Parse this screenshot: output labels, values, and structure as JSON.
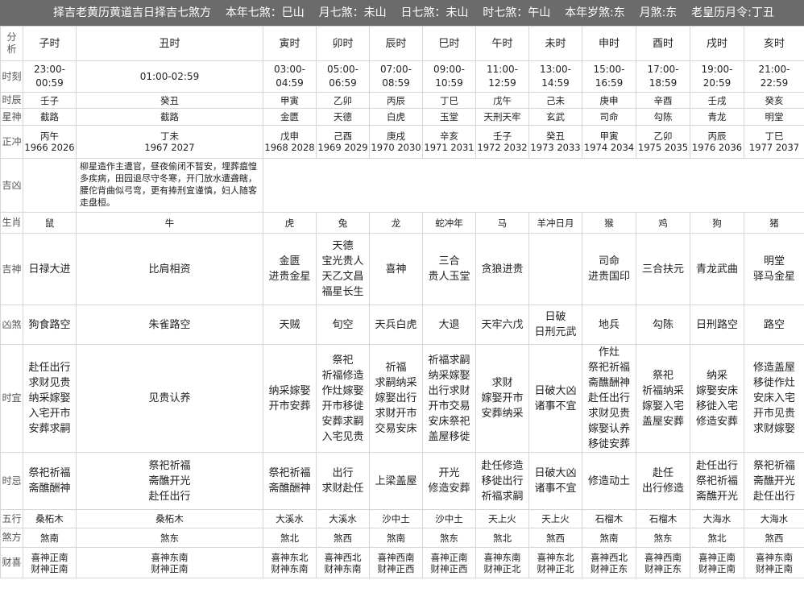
{
  "header": {
    "title": "择吉老黄历黄道吉日择吉七煞方",
    "year_sha": "本年七煞：巳山",
    "month_sha": "月七煞：未山",
    "day_sha": "日七煞：未山",
    "hour_sha": "时七煞：午山",
    "year_sui": "本年岁煞:东",
    "month_sha2": "月煞:东",
    "lunar_month": "老皇历月令:丁丑"
  },
  "row_labels": {
    "fenxi": "分\n析",
    "shike": "时刻",
    "shichen": "时辰",
    "xingshen": "星神",
    "zhengchong": "正冲",
    "jixiong": "吉凶",
    "shengxiao": "生肖",
    "jishen": "吉神",
    "xiongsha": "凶煞",
    "shiyi": "时宜",
    "shiji": "时忌",
    "wuxing": "五行",
    "shafang": "煞方",
    "caixi": "财喜"
  },
  "hours": [
    {
      "name": "子时",
      "time": "23:00-\n00:59",
      "ganzhi": "壬子",
      "star": "截路",
      "chong": "丙午\n1966 2026",
      "jixiong": "",
      "animal": "鼠",
      "jishen": "日禄大进",
      "xiongsha": "狗食路空",
      "yi": "赴任出行\n求财见贵\n纳采嫁娶\n入宅开市\n安葬求嗣",
      "ji": "祭祀祈福\n斋醮酬神",
      "wuxing": "桑柘木",
      "shafang": "煞南",
      "caixi": "喜神正南\n财神正南"
    },
    {
      "name": "丑时",
      "time": "01:00-02:59",
      "ganzhi": "癸丑",
      "star": "截路",
      "chong": "丁未\n1967 2027",
      "jixiong": "柳星造作主遭官，昼夜偷闭不暂安，埋葬瘟惶多疾病，田园退尽守冬寒，开门放水遭聋瞎，腰佗背曲似弓弯，更有捧刑宜谨慎，妇人随客走盘桓。",
      "animal": "牛",
      "jishen": "比肩相资",
      "xiongsha": "朱雀路空",
      "yi": "见贵认养",
      "ji": "祭祀祈福\n斋醮开光\n赴任出行",
      "wuxing": "桑柘木",
      "shafang": "煞东",
      "caixi": "喜神东南\n财神正南"
    },
    {
      "name": "寅时",
      "time": "03:00-\n04:59",
      "ganzhi": "甲寅",
      "star": "金匮",
      "chong": "戊申\n1968 2028",
      "jixiong": "",
      "animal": "虎",
      "jishen": "金匮\n进贵金星",
      "xiongsha": "天贼",
      "yi": "纳采嫁娶\n开市安葬",
      "ji": "祭祀祈福\n斋醮酬神",
      "wuxing": "大溪水",
      "shafang": "煞北",
      "caixi": "喜神东北\n财神东南"
    },
    {
      "name": "卯时",
      "time": "05:00-\n06:59",
      "ganzhi": "乙卯",
      "star": "天德",
      "chong": "己酉\n1969 2029",
      "jixiong": "",
      "animal": "兔",
      "jishen": "天德\n宝光贵人\n天乙文昌\n福星长生",
      "xiongsha": "旬空",
      "yi": "祭祀\n祈福修造\n作灶嫁娶\n开市移徙\n安葬求嗣\n入宅见贵",
      "ji": "出行\n求财赴任",
      "wuxing": "大溪水",
      "shafang": "煞西",
      "caixi": "喜神西北\n财神东南"
    },
    {
      "name": "辰时",
      "time": "07:00-\n08:59",
      "ganzhi": "丙辰",
      "star": "白虎",
      "chong": "庚戌\n1970 2030",
      "jixiong": "",
      "animal": "龙",
      "jishen": "喜神",
      "xiongsha": "天兵白虎",
      "yi": "祈福\n求嗣纳采\n嫁娶出行\n求财开市\n交易安床",
      "ji": "上梁盖屋",
      "wuxing": "沙中土",
      "shafang": "煞南",
      "caixi": "喜神西南\n财神正西"
    },
    {
      "name": "巳时",
      "time": "09:00-\n10:59",
      "ganzhi": "丁巳",
      "star": "玉堂",
      "chong": "辛亥\n1971 2031",
      "jixiong": "",
      "animal": "蛇冲年",
      "jishen": "三合\n贵人玉堂",
      "xiongsha": "大退",
      "yi": "祈福求嗣\n纳采嫁娶\n出行求财\n开市交易\n安床祭祀\n盖屋移徙",
      "ji": "开光\n修造安葬",
      "wuxing": "沙中土",
      "shafang": "煞东",
      "caixi": "喜神正南\n财神正西"
    },
    {
      "name": "午时",
      "time": "11:00-\n12:59",
      "ganzhi": "戊午",
      "star": "天刑天牢",
      "chong": "壬子\n1972 2032",
      "jixiong": "",
      "animal": "马",
      "jishen": "贪狼进贵",
      "xiongsha": "天牢六戊",
      "yi": "求财\n嫁娶开市\n安葬纳采",
      "ji": "赴任修造\n移徙出行\n祈福求嗣",
      "wuxing": "天上火",
      "shafang": "煞北",
      "caixi": "喜神东南\n财神正北"
    },
    {
      "name": "未时",
      "time": "13:00-\n14:59",
      "ganzhi": "己未",
      "star": "玄武",
      "chong": "癸丑\n1973 2033",
      "jixiong": "",
      "animal": "羊冲日月",
      "jishen": "",
      "xiongsha": "日破\n日刑元武",
      "yi": "日破大凶\n诸事不宜",
      "ji": "日破大凶\n诸事不宜",
      "wuxing": "天上火",
      "shafang": "煞西",
      "caixi": "喜神东北\n财神正北"
    },
    {
      "name": "申时",
      "time": "15:00-\n16:59",
      "ganzhi": "庚申",
      "star": "司命",
      "chong": "甲寅\n1974 2034",
      "jixiong": "",
      "animal": "猴",
      "jishen": "司命\n进贵国印",
      "xiongsha": "地兵",
      "yi": "作灶\n祭祀祈福\n斋醮酬神\n赴任出行\n求财见贵\n嫁娶认养\n移徙安葬",
      "ji": "修造动土",
      "wuxing": "石榴木",
      "shafang": "煞南",
      "caixi": "喜神西北\n财神正东"
    },
    {
      "name": "酉时",
      "time": "17:00-\n18:59",
      "ganzhi": "辛酉",
      "star": "勾陈",
      "chong": "乙卯\n1975 2035",
      "jixiong": "",
      "animal": "鸡",
      "jishen": "三合扶元",
      "xiongsha": "勾陈",
      "yi": "祭祀\n祈福纳采\n嫁娶入宅\n盖屋安葬",
      "ji": "赴任\n出行修造",
      "wuxing": "石榴木",
      "shafang": "煞东",
      "caixi": "喜神西南\n财神正东"
    },
    {
      "name": "戌时",
      "time": "19:00-\n20:59",
      "ganzhi": "壬戌",
      "star": "青龙",
      "chong": "丙辰\n1976 2036",
      "jixiong": "",
      "animal": "狗",
      "jishen": "青龙武曲",
      "xiongsha": "日刑路空",
      "yi": "纳采\n嫁娶安床\n移徙入宅\n修造安葬",
      "ji": "赴任出行\n祭祀祈福\n斋醮开光",
      "wuxing": "大海水",
      "shafang": "煞北",
      "caixi": "喜神正南\n财神正南"
    },
    {
      "name": "亥时",
      "time": "21:00-\n22:59",
      "ganzhi": "癸亥",
      "star": "明堂",
      "chong": "丁巳\n1977 2037",
      "jixiong": "",
      "animal": "猪",
      "jishen": "明堂\n驿马金星",
      "xiongsha": "路空",
      "yi": "修造盖屋\n移徙作灶\n安床入宅\n开市见贵\n求财嫁娶",
      "ji": "祭祀祈福\n斋醮开光\n赴任出行",
      "wuxing": "大海水",
      "shafang": "煞西",
      "caixi": "喜神东南\n财神正南"
    }
  ]
}
